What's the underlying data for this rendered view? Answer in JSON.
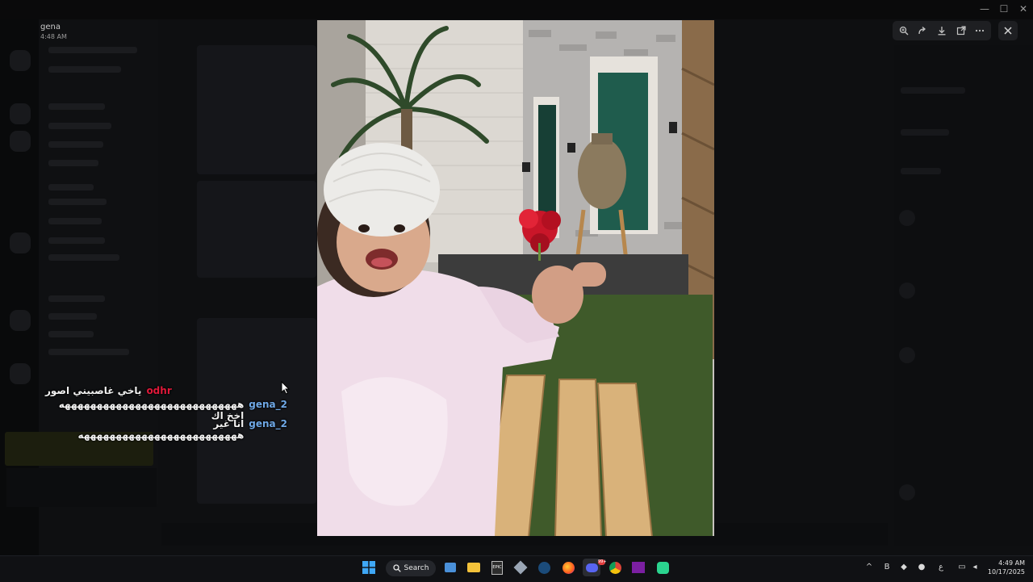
{
  "viewer": {
    "uploader_name": "gena",
    "uploader_time": "4:48 AM",
    "toolbar": {
      "zoom_icon": "zoom-in-icon",
      "forward_icon": "forward-icon",
      "download_icon": "download-icon",
      "open_icon": "open-external-icon",
      "more_icon": "more-icon"
    },
    "close_icon": "close-icon"
  },
  "chat": [
    {
      "user": "odhr",
      "user_color": "#e0193a",
      "message": "ياخي غاصبيني اصور"
    },
    {
      "user": "gena_2",
      "user_color": "#6fa8e6",
      "message": "ههههههههههههههههههههههههههههه اخخ اك"
    },
    {
      "user": "gena_2",
      "user_color": "#6fa8e6",
      "message": "انا غير هههههههههههههههههههههههههه"
    }
  ],
  "taskbar": {
    "search_label": "Search",
    "discord_badge": "99+",
    "time": "4:49 AM",
    "date": "10/17/2025",
    "tray_lang": "ع"
  },
  "colors": {
    "overlay_bg": "#0b0c0e",
    "toolbar_bg": "#1e1f22"
  }
}
